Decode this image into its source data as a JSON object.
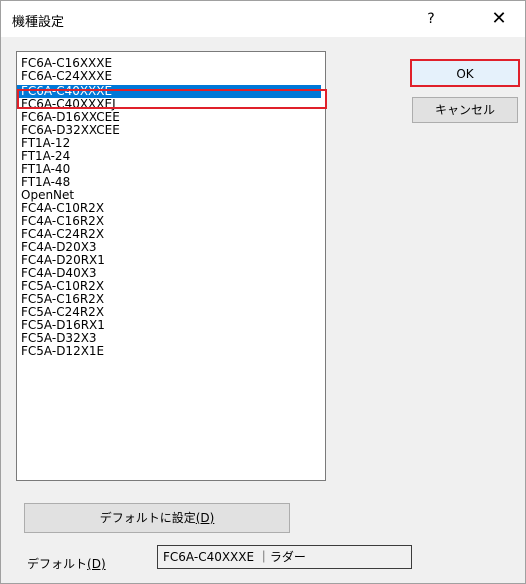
{
  "window": {
    "title": "機種設定",
    "help_glyph": "?",
    "close_glyph": "✕"
  },
  "list": {
    "items": [
      "FC6A-C16XXXE",
      "FC6A-C24XXXE",
      "FC6A-C40XXXE",
      "FC6A-C40XXXEJ",
      "FC6A-D16XXCEE",
      "FC6A-D32XXCEE",
      "FT1A-12",
      "FT1A-24",
      "FT1A-40",
      "FT1A-48",
      "OpenNet",
      "FC4A-C10R2X",
      "FC4A-C16R2X",
      "FC4A-C24R2X",
      "FC4A-D20X3",
      "FC4A-D20RX1",
      "FC4A-D40X3",
      "FC5A-C10R2X",
      "FC5A-C16R2X",
      "FC5A-C24R2X",
      "FC5A-D16RX1",
      "FC5A-D32X3",
      "FC5A-D12X1E"
    ],
    "selected": "FC6A-C40XXXE"
  },
  "buttons": {
    "ok": "OK",
    "cancel": "キャンセル",
    "set_default_text": "デフォルトに設定",
    "set_default_key": "(D)"
  },
  "default": {
    "label_text": "デフォルト",
    "label_key": "(D)",
    "value": "FC6A-C40XXXE ｜ラダー"
  },
  "colors": {
    "selection": "#0078d7",
    "highlight_border": "#e0202a"
  }
}
